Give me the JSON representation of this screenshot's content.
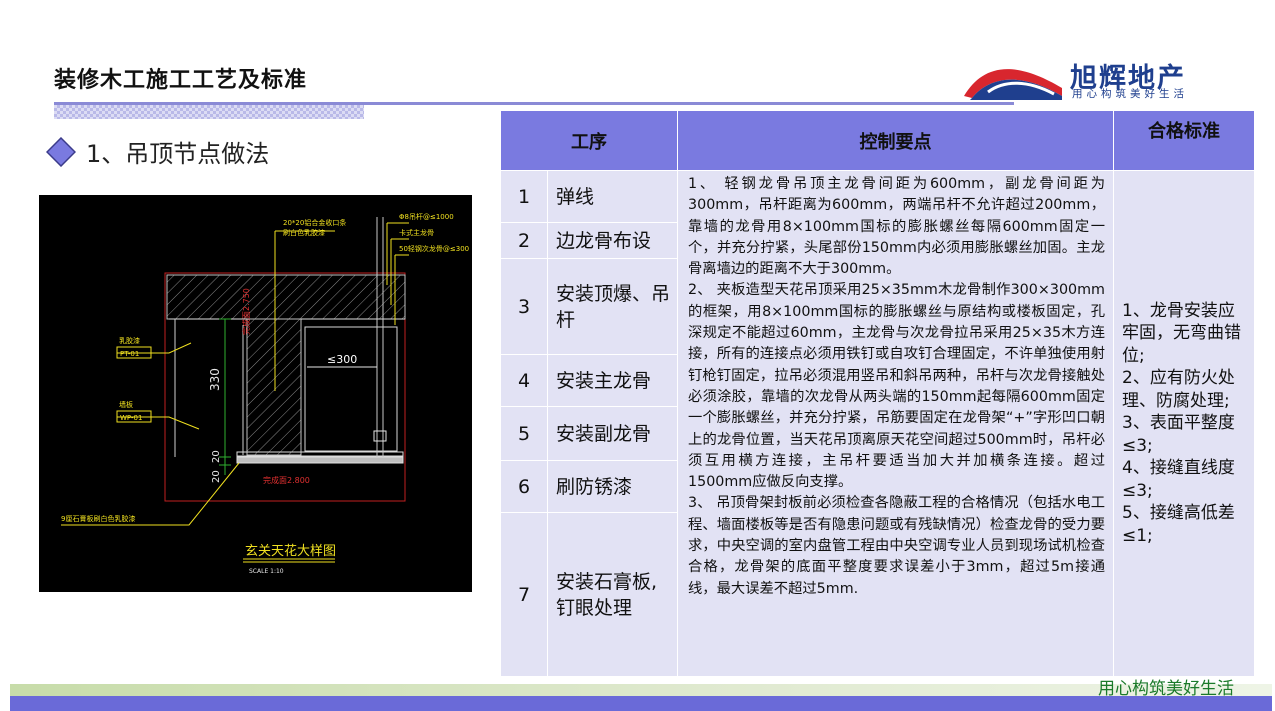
{
  "page": {
    "title": "装修木工施工工艺及标准",
    "section": "1、吊顶节点做法",
    "footer_slogan": "用心构筑美好生活"
  },
  "logo": {
    "name": "旭辉地产",
    "slogan": "用心构筑美好生活",
    "colors": {
      "red": "#d8262e",
      "blue": "#1f3f8e"
    }
  },
  "drawing": {
    "title": "玄关天花大样图",
    "scale": "SCALE 1:10",
    "labels": {
      "finish_edge": "20*20铝合金收口条",
      "finish_edge_sub": "刷白色乳胶漆",
      "hanger_bolt": "Φ8吊杆@≤1000",
      "main_keel": "卡式主龙骨",
      "sub_keel": "50轻钢次龙骨@≤300",
      "latex_paint": "乳胶漆",
      "latex_code": "PT-01",
      "wall_cloth": "墙板",
      "wall_code": "WP-01",
      "gypsum_board": "9厘石膏板刷白色乳胶漆",
      "dim_300": "≤300",
      "dim_330": "330",
      "dim_20a": "20",
      "dim_20b": "20",
      "ceiling_height": "完成面2.750",
      "floor_height": "完成面2.800"
    }
  },
  "table": {
    "headers": {
      "process": "工序",
      "key_points": "控制要点",
      "standard": "合格标准"
    },
    "rows": [
      {
        "num": "1",
        "step": "弹线"
      },
      {
        "num": "2",
        "step": "边龙骨布设"
      },
      {
        "num": "3",
        "step": "安装顶爆、吊杆"
      },
      {
        "num": "4",
        "step": "安装主龙骨"
      },
      {
        "num": "5",
        "step": "安装副龙骨"
      },
      {
        "num": "6",
        "step": "刷防锈漆"
      },
      {
        "num": "7",
        "step": "安装石膏板,钉眼处理"
      }
    ],
    "key_points": [
      "1、 轻钢龙骨吊顶主龙骨间距为600mm，副龙骨间距为300mm，吊杆距离为600mm，两端吊杆不允许超过200mm，靠墙的龙骨用8×100mm国标的膨胀螺丝每隔600mm固定一个，并充分拧紧，头尾部份150mm内必须用膨胀螺丝加固。主龙骨离墙边的距离不大于300mm。",
      "2、 夹板造型天花吊顶采用25×35mm木龙骨制作300×300mm的框架，用8×100mm国标的膨胀螺丝与原结构或楼板固定，孔深规定不能超过60mm，主龙骨与次龙骨拉吊采用25×35木方连接，所有的连接点必须用铁钉或自攻钉合理固定，不许单独使用射钉枪钉固定，拉吊必须混用竖吊和斜吊两种，吊杆与次龙骨接触处必须涂胶，靠墙的次龙骨从两头端的150mm起每隔600mm固定一个膨胀螺丝，并充分拧紧，吊筋要固定在龙骨架“+”字形凹口朝上的龙骨位置，当天花吊顶离原天花空间超过500mm时，吊杆必须互用横方连接，主吊杆要适当加大并加横条连接。超过1500mm应做反向支撑。",
      "3、 吊顶骨架封板前必须检查各隐蔽工程的合格情况（包括水电工程、墙面楼板等是否有隐患问题或有残缺情况）检查龙骨的受力要求，中央空调的室内盘管工程由中央空调专业人员到现场试机检查合格，龙骨架的底面平整度要求误差小于3mm，超过5m接通线，最大误差不超过5mm."
    ],
    "standards": [
      "1、龙骨安装应牢固，无弯曲错位;",
      "2、应有防火处理、防腐处理;",
      "3、表面平整度≤3;",
      "4、接缝直线度≤3;",
      "5、接缝高低差≤1;"
    ]
  }
}
